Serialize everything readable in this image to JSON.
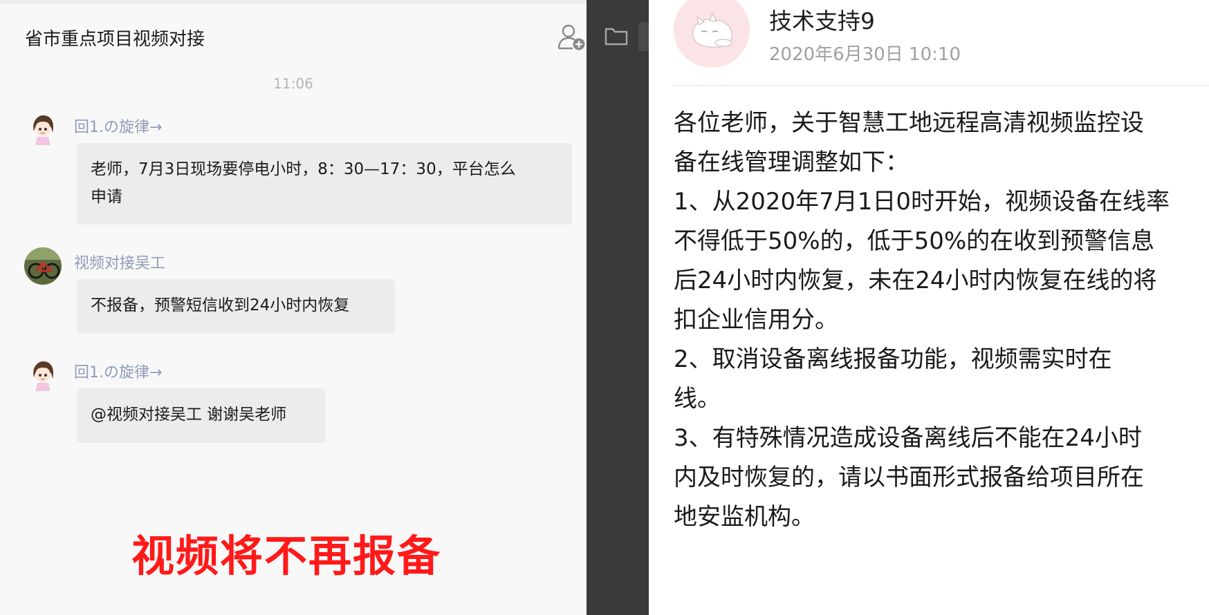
{
  "chat": {
    "title": "省市重点项目视频对接",
    "timestamp": "11:06",
    "messages": [
      {
        "sender": "回1.の旋律→",
        "lines": [
          "老师，7月3日现场要停电小时，8：30—17：30，平台怎么",
          "申请"
        ]
      },
      {
        "sender": "视频对接吴工",
        "lines": [
          "不报备，预警短信收到24小时内恢复"
        ]
      },
      {
        "sender": "回1.の旋律→",
        "lines": [
          "@视频对接吴工 谢谢吴老师"
        ]
      }
    ]
  },
  "annotation": "视频将不再报备",
  "notice": {
    "author": "技术支持9",
    "date": "2020年6月30日 10:10",
    "lines": [
      "各位老师，关于智慧工地远程高清视频监控设",
      "备在线管理调整如下：",
      "1、从2020年7月1日0时开始，视频设备在线率",
      "不得低于50%的，低于50%的在收到预警信息",
      "后24小时内恢复，未在24小时内恢复在线的将",
      "扣企业信用分。",
      "2、取消设备离线报备功能，视频需实时在",
      "线。",
      "3、有特殊情况造成设备离线后不能在24小时",
      "内及时恢复的，请以书面形式报备给项目所在",
      "地安监机构。"
    ]
  },
  "icons": {
    "add_member": "add-member-icon",
    "folder": "folder-icon",
    "avatar_girl": "cartoon-girl-avatar",
    "avatar_bike": "bicycle-photo-avatar",
    "avatar_cat": "cat-avatar"
  },
  "colors": {
    "sender_name": "#8f9bb8",
    "bubble": "#ececec",
    "annotation": "#ff1a1a",
    "divider": "#3a3a3a"
  }
}
